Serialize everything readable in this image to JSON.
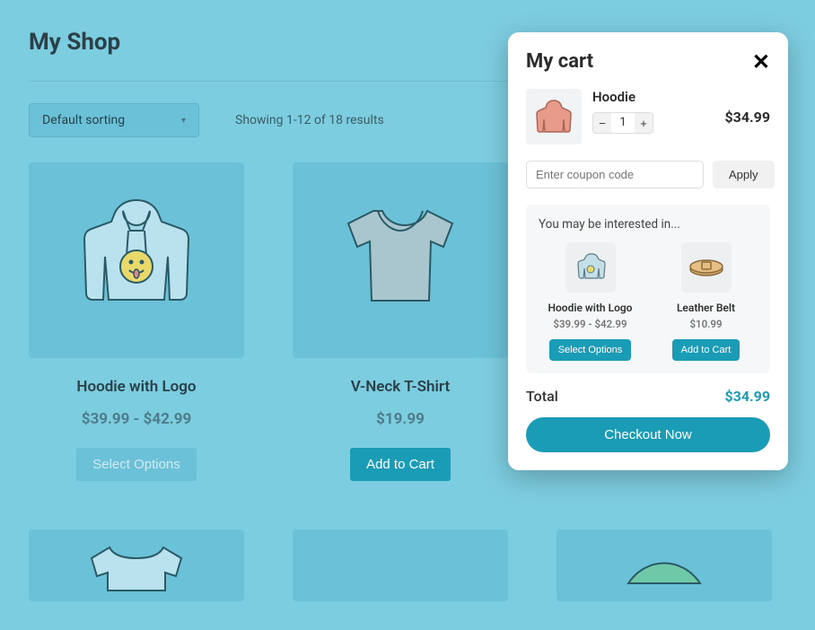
{
  "shop": {
    "title": "My Shop",
    "sort_label": "Default sorting",
    "results_text": "Showing 1-12 of 18 results",
    "products": [
      {
        "name": "Hoodie with Logo",
        "price": "$39.99 - $42.99",
        "cta": "Select Options",
        "cta_primary": false
      },
      {
        "name": "V-Neck T-Shirt",
        "price": "$19.99",
        "cta": "Add to Cart",
        "cta_primary": true
      }
    ]
  },
  "cart": {
    "title": "My cart",
    "item": {
      "name": "Hoodie",
      "qty": "1",
      "price": "$34.99"
    },
    "coupon": {
      "placeholder": "Enter coupon code",
      "apply_label": "Apply"
    },
    "suggest": {
      "title": "You may be interested in...",
      "items": [
        {
          "name": "Hoodie with Logo",
          "price": "$39.99 - $42.99",
          "cta": "Select Options"
        },
        {
          "name": "Leather Belt",
          "price": "$10.99",
          "cta": "Add to Cart"
        }
      ]
    },
    "total_label": "Total",
    "total_value": "$34.99",
    "checkout_label": "Checkout Now"
  }
}
